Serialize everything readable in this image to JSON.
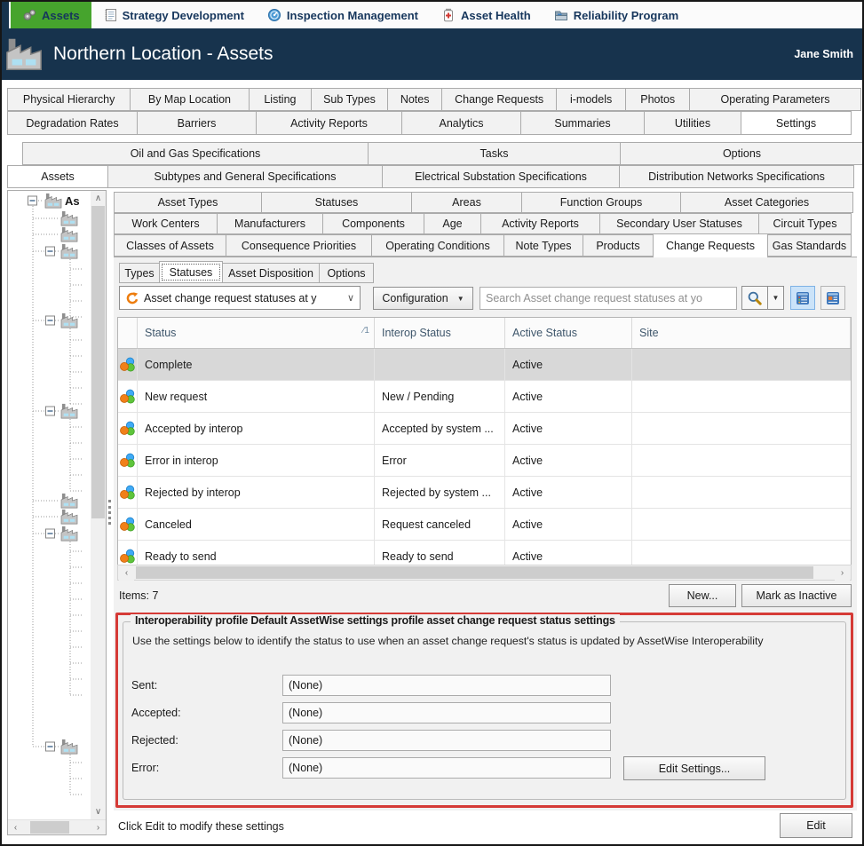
{
  "menu": {
    "items": [
      {
        "label": "Assets"
      },
      {
        "label": "Strategy Development"
      },
      {
        "label": "Inspection Management"
      },
      {
        "label": "Asset Health"
      },
      {
        "label": "Reliability Program"
      }
    ]
  },
  "header": {
    "title": "Northern Location - Assets",
    "user": "Jane Smith"
  },
  "outer_tabs": {
    "row1": [
      "Physical Hierarchy",
      "By Map Location",
      "Listing",
      "Sub Types",
      "Notes",
      "Change Requests",
      "i-models",
      "Photos",
      "Operating Parameters"
    ],
    "row2": [
      "Degradation Rates",
      "Barriers",
      "Activity Reports",
      "Analytics",
      "Summaries",
      "Utilities",
      "Settings"
    ],
    "selected": "Settings"
  },
  "section_tabs": {
    "row1": [
      "Oil and Gas Specifications",
      "Tasks",
      "Options"
    ],
    "row2": [
      "Assets",
      "Subtypes and General Specifications",
      "Electrical Substation Specifications",
      "Distribution Networks Specifications"
    ],
    "selected": "Assets"
  },
  "tree": {
    "root_label": "As"
  },
  "settings_tabs": {
    "row1": [
      "Asset Types",
      "Statuses",
      "Areas",
      "Function Groups",
      "Asset Categories"
    ],
    "row2": [
      "Work Centers",
      "Manufacturers",
      "Components",
      "Age",
      "Activity Reports",
      "Secondary User Statuses",
      "Circuit Types"
    ],
    "row3": [
      "Classes of Assets",
      "Consequence Priorities",
      "Operating Conditions",
      "Note Types",
      "Products",
      "Change Requests",
      "Gas Standards"
    ],
    "selected": "Change Requests"
  },
  "subtabs": {
    "items": [
      "Types",
      "Statuses",
      "Asset Disposition",
      "Options"
    ],
    "selected": "Statuses"
  },
  "toolbar": {
    "scope_dropdown": "Asset change request statuses at y",
    "configuration_button": "Configuration",
    "search_placeholder": "Search Asset change request statuses at yo"
  },
  "table": {
    "columns": [
      "Status",
      "Interop Status",
      "Active Status",
      "Site"
    ],
    "sort_indicator": "∕1",
    "rows": [
      {
        "status": "Complete",
        "interop": "",
        "active": "Active",
        "site": ""
      },
      {
        "status": "New request",
        "interop": "New / Pending",
        "active": "Active",
        "site": ""
      },
      {
        "status": "Accepted by interop",
        "interop": "Accepted by system ...",
        "active": "Active",
        "site": ""
      },
      {
        "status": "Error in interop",
        "interop": "Error",
        "active": "Active",
        "site": ""
      },
      {
        "status": "Rejected by interop",
        "interop": "Rejected by system ...",
        "active": "Active",
        "site": ""
      },
      {
        "status": "Canceled",
        "interop": "Request canceled",
        "active": "Active",
        "site": ""
      },
      {
        "status": "Ready to send",
        "interop": "Ready to send",
        "active": "Active",
        "site": ""
      }
    ],
    "items_text": "Items: 7",
    "new_button": "New...",
    "mark_inactive_button": "Mark as Inactive"
  },
  "interop_settings": {
    "title": "Interoperability profile Default AssetWise settings profile asset change request status settings",
    "description": "Use the settings below to identify the status to use when an asset change request's status is updated by AssetWise Interoperability",
    "fields": [
      {
        "label": "Sent:",
        "value": "(None)"
      },
      {
        "label": "Accepted:",
        "value": "(None)"
      },
      {
        "label": "Rejected:",
        "value": "(None)"
      },
      {
        "label": "Error:",
        "value": "(None)"
      }
    ],
    "edit_settings_button": "Edit Settings..."
  },
  "footer": {
    "hint": "Click Edit to modify these settings",
    "edit_button": "Edit"
  },
  "colors": {
    "accent_green": "#46A42D",
    "title_bar_navy": "#17334D",
    "highlight_red": "#D53A36",
    "selection_gray": "#D8D8D8",
    "refresh_orange": "#ED7D0E"
  }
}
